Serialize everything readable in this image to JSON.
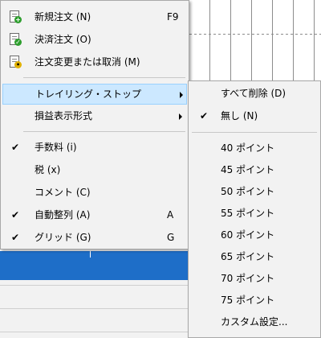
{
  "colors": {
    "menu_bg": "#f2f2f2",
    "selected_bg": "#cce8ff",
    "selected_border": "#99d1ff",
    "chart_bar": "#1e6ec8",
    "new_order_badge": "#2e9e2e",
    "close_order_badge": "#2e9e2e",
    "modify_order_badge": "#e0b000"
  },
  "main_menu": {
    "items": [
      {
        "label": "新規注文 (N)",
        "shortcut": "F9",
        "icon": "new-order-icon"
      },
      {
        "label": "決済注文 (O)",
        "icon": "close-order-icon"
      },
      {
        "label": "注文変更または取消 (M)",
        "icon": "modify-order-icon"
      },
      {
        "label": "トレイリング・ストップ",
        "submenu": true,
        "selected": true
      },
      {
        "label": "損益表示形式",
        "submenu": true
      },
      {
        "label": "手数料 (i)",
        "checked": true
      },
      {
        "label": "税 (x)"
      },
      {
        "label": "コメント (C)"
      },
      {
        "label": "自動整列 (A)",
        "shortcut": "A",
        "checked": true
      },
      {
        "label": "グリッド (G)",
        "shortcut": "G",
        "checked": true
      }
    ]
  },
  "submenu": {
    "items": [
      {
        "label": "すべて削除 (D)"
      },
      {
        "label": "無し (N)",
        "checked": true
      },
      {
        "label": "40 ポイント"
      },
      {
        "label": "45 ポイント"
      },
      {
        "label": "50 ポイント"
      },
      {
        "label": "55 ポイント"
      },
      {
        "label": "60 ポイント"
      },
      {
        "label": "65 ポイント"
      },
      {
        "label": "70 ポイント"
      },
      {
        "label": "75 ポイント"
      },
      {
        "label": "カスタム設定..."
      }
    ]
  },
  "glyphs": {
    "check": "✔"
  }
}
